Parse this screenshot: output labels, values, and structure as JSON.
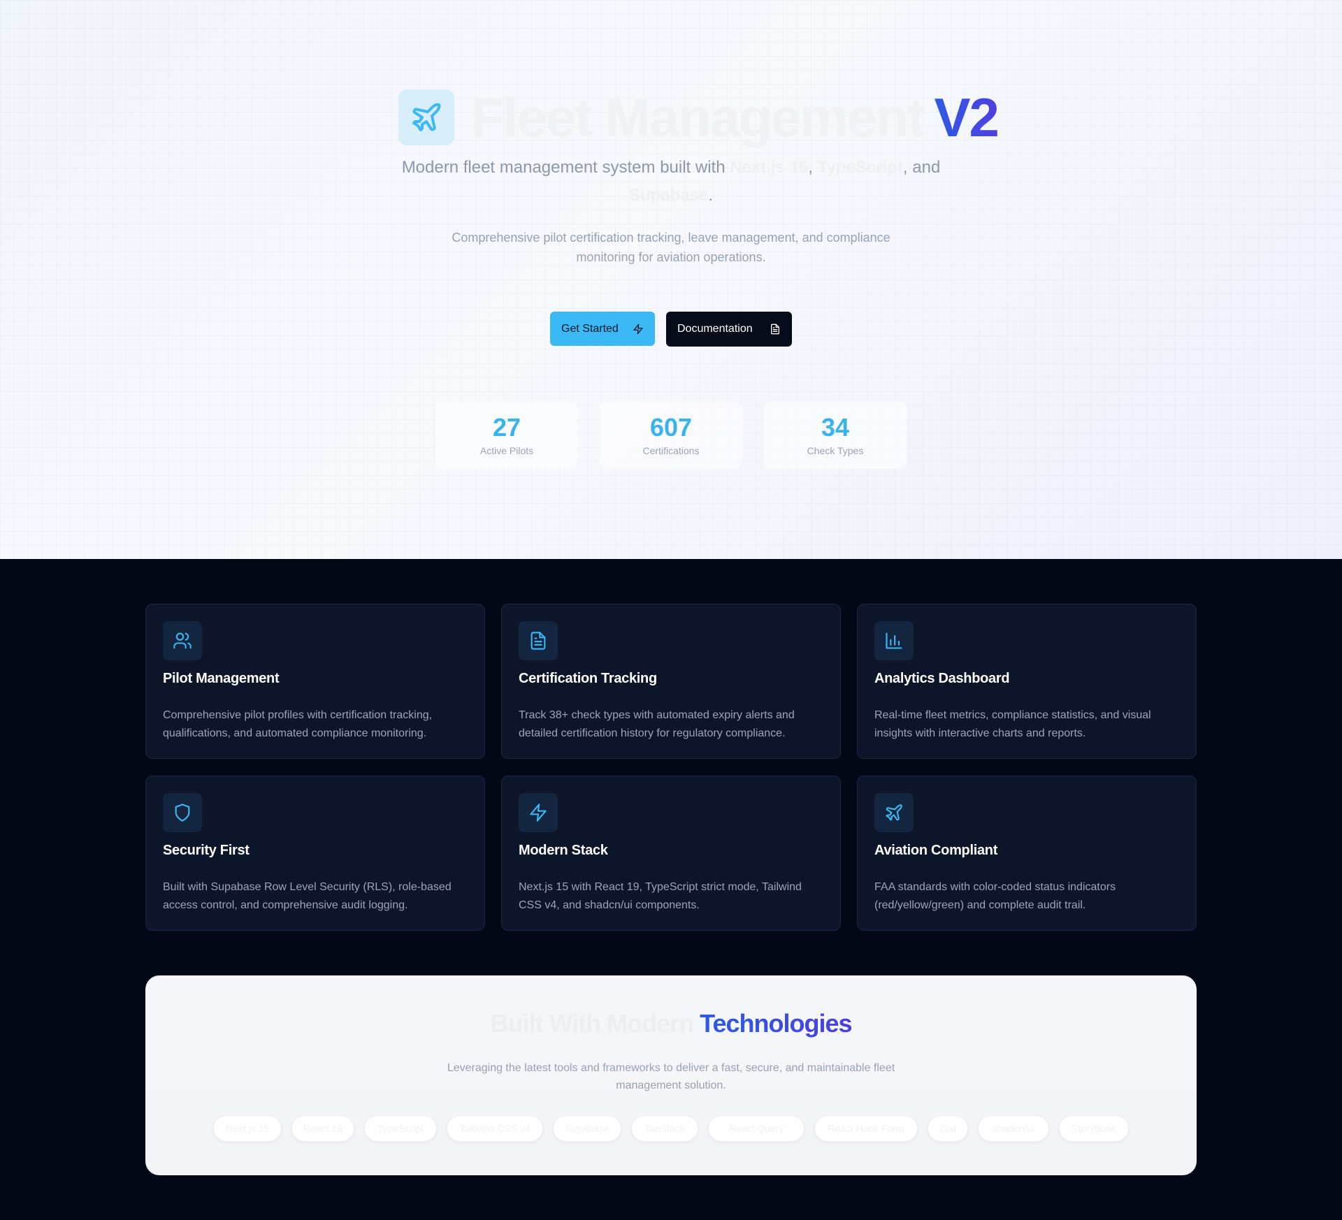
{
  "hero": {
    "title_faint": "Fleet Management",
    "title_accent": "V2",
    "subtitle_start": "Modern fleet management system built with ",
    "tech_next": "Next.js 15",
    "comma": ",",
    "tech_ts": "TypeScript",
    "subtitle_and": ", and",
    "tech_supabase": "Supabase",
    "period": ".",
    "description": "Comprehensive pilot certification tracking, leave management, and compliance monitoring for aviation operations.",
    "buttons": {
      "get_started": "Get Started",
      "documentation": "Documentation"
    },
    "stats": [
      {
        "value": "27",
        "label": "Active Pilots"
      },
      {
        "value": "607",
        "label": "Certifications"
      },
      {
        "value": "34",
        "label": "Check Types"
      }
    ]
  },
  "features": [
    {
      "title": "Pilot Management",
      "description": "Comprehensive pilot profiles with certification tracking, qualifications, and automated compliance monitoring.",
      "icon": "users-icon"
    },
    {
      "title": "Certification Tracking",
      "description": "Track 38+ check types with automated expiry alerts and detailed certification history for regulatory compliance.",
      "icon": "file-text-icon"
    },
    {
      "title": "Analytics Dashboard",
      "description": "Real-time fleet metrics, compliance statistics, and visual insights with interactive charts and reports.",
      "icon": "bar-chart-icon"
    },
    {
      "title": "Security First",
      "description": "Built with Supabase Row Level Security (RLS), role-based access control, and comprehensive audit logging.",
      "icon": "shield-icon"
    },
    {
      "title": "Modern Stack",
      "description": "Next.js 15 with React 19, TypeScript strict mode, Tailwind CSS v4, and shadcn/ui components.",
      "icon": "zap-icon"
    },
    {
      "title": "Aviation Compliant",
      "description": "FAA standards with color-coded status indicators (red/yellow/green) and complete audit trail.",
      "icon": "plane-icon"
    }
  ],
  "tech": {
    "title_faint": "Built With Modern",
    "title_accent": "Technologies",
    "description": "Leveraging the latest tools and frameworks to deliver a fast, secure, and maintainable fleet management solution.",
    "pills": [
      "Next.js 15",
      "React 19",
      "TypeScript",
      "Tailwind CSS v4",
      "Supabase",
      "TanStack",
      "React Query",
      "React Hook Form",
      "Zod",
      "shadcn/ui",
      "Storybook"
    ]
  },
  "colors": {
    "accent": "#3bb9f5",
    "brand_gradient_start": "#2d5be3",
    "brand_gradient_end": "#4f3fe0",
    "dark_bg": "#030817",
    "card_bg": "#0d1629"
  }
}
